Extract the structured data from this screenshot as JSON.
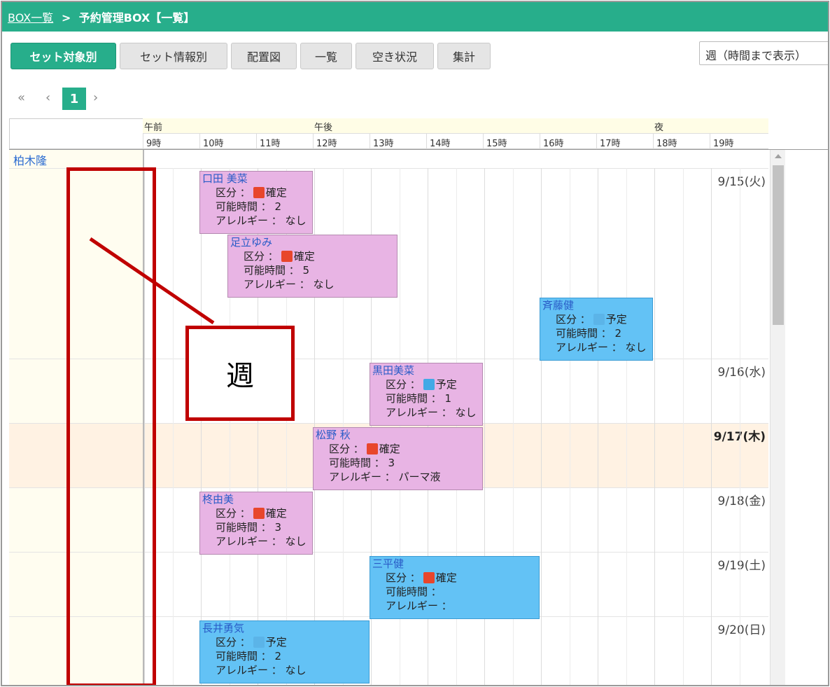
{
  "breadcrumb": {
    "link": "BOX一覧",
    "separator": ">",
    "current": "予約管理BOX【一覧】"
  },
  "tabs": [
    {
      "label": "セット対象別",
      "active": true
    },
    {
      "label": "セット情報別",
      "active": false
    },
    {
      "label": "配置図",
      "active": false
    },
    {
      "label": "一覧",
      "active": false
    },
    {
      "label": "空き状況",
      "active": false
    },
    {
      "label": "集計",
      "active": false
    }
  ],
  "view_select": {
    "value": "週（時間まで表示）"
  },
  "pager": {
    "first": "«",
    "prev": "‹",
    "current": "1",
    "next": "›"
  },
  "timeline": {
    "periods": [
      "午前",
      "午後",
      "夜"
    ],
    "hours": [
      "9時",
      "10時",
      "11時",
      "12時",
      "13時",
      "14時",
      "15時",
      "16時",
      "17時",
      "18時",
      "19時"
    ],
    "person": "柏木隆",
    "days": [
      {
        "label": "9/15(火)",
        "today": false
      },
      {
        "label": "9/16(水)",
        "today": false
      },
      {
        "label": "9/17(木)",
        "today": true
      },
      {
        "label": "9/18(金)",
        "today": false
      },
      {
        "label": "9/19(土)",
        "today": false
      },
      {
        "label": "9/20(日)",
        "today": false
      }
    ],
    "events": [
      {
        "name": "口田 美菜",
        "category_label": "区分 ：",
        "category": "確定",
        "status_color": "#e8462c",
        "hours_label": "可能時間 ： 2",
        "allergy_label": "アレルギー ： なし",
        "color": "pink"
      },
      {
        "name": "足立ゆみ",
        "category_label": "区分 ：",
        "category": "確定",
        "status_color": "#e8462c",
        "hours_label": "可能時間 ： 5",
        "allergy_label": "アレルギー ： なし",
        "color": "pink"
      },
      {
        "name": "斉藤健",
        "category_label": "区分 ：",
        "category": "予定",
        "status_color": "#5bb4e8",
        "hours_label": "可能時間 ： 2",
        "allergy_label": "アレルギー ： なし",
        "color": "blue"
      },
      {
        "name": "黒田美菜",
        "category_label": "区分 ：",
        "category": "予定",
        "status_color": "#42a9e6",
        "hours_label": "可能時間 ： 1",
        "allergy_label": "アレルギー ： なし",
        "color": "pink"
      },
      {
        "name": "松野 秋",
        "category_label": "区分 ：",
        "category": "確定",
        "status_color": "#e8462c",
        "hours_label": "可能時間 ： 3",
        "allergy_label": "アレルギー ： パーマ液",
        "color": "pink"
      },
      {
        "name": "柊由美",
        "category_label": "区分 ：",
        "category": "確定",
        "status_color": "#e8462c",
        "hours_label": "可能時間 ： 3",
        "allergy_label": "アレルギー ： なし",
        "color": "pink"
      },
      {
        "name": "三平健",
        "category_label": "区分 ：",
        "category": "確定",
        "status_color": "#e8462c",
        "hours_label": "可能時間 ：",
        "allergy_label": "アレルギー ：",
        "color": "blue"
      },
      {
        "name": "長井勇気",
        "category_label": "区分 ：",
        "category": "予定",
        "status_color": "#5bb4e8",
        "hours_label": "可能時間 ： 2",
        "allergy_label": "アレルギー ： なし",
        "color": "blue"
      }
    ]
  },
  "annotation": {
    "label": "週",
    "color": "#c00000"
  }
}
